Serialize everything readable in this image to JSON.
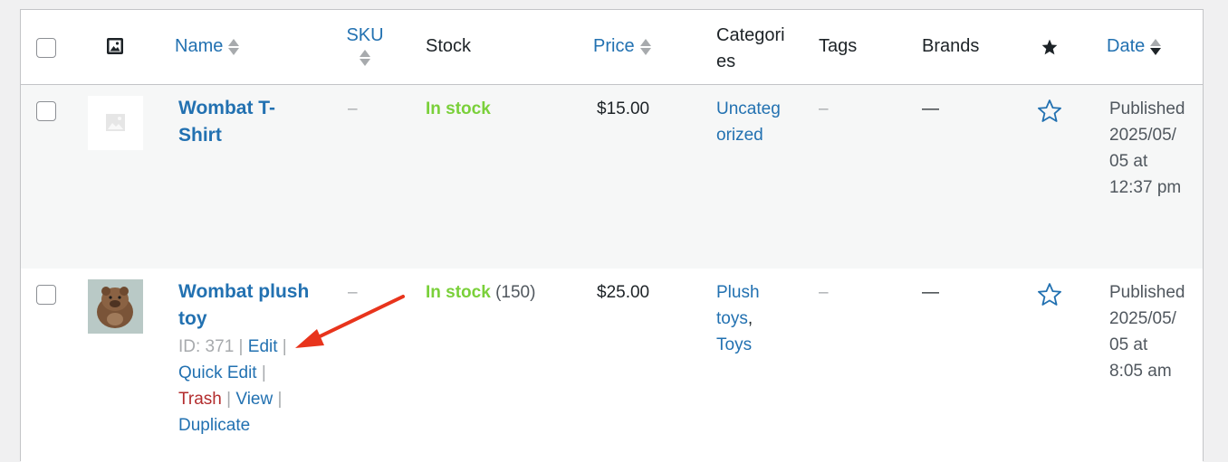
{
  "header": {
    "name": "Name",
    "sku": "SKU",
    "stock": "Stock",
    "price": "Price",
    "categories_1": "Categori",
    "categories_2": "es",
    "tags": "Tags",
    "brands": "Brands",
    "date": "Date",
    "thumb_icon": "image-icon",
    "featured_icon": "star-filled-icon"
  },
  "rows": [
    {
      "name_1": "Wombat T-",
      "name_2": "Shirt",
      "sku": "–",
      "stock": "In stock",
      "stock_qty": "",
      "price": "$15.00",
      "cat_1": "Uncateg",
      "cat_2": "orized",
      "tags": "–",
      "brands": "—",
      "date_1": "Published",
      "date_2": "2025/05/",
      "date_3": "05 at",
      "date_4": "12:37 pm"
    },
    {
      "name_1": "Wombat plush",
      "name_2": "toy",
      "id_label": "ID: 371",
      "edit": "Edit",
      "quick_edit": "Quick Edit",
      "trash": "Trash",
      "view": "View",
      "duplicate": "Duplicate",
      "sep": "|",
      "sku": "–",
      "stock": "In stock",
      "stock_qty": "(150)",
      "price": "$25.00",
      "cat_1": "Plush",
      "cat_2": "toys",
      "cat_comma": ",",
      "cat_3": "Toys",
      "tags": "–",
      "brands": "—",
      "date_1": "Published",
      "date_2": "2025/05/",
      "date_3": "05 at",
      "date_4": "8:05 am"
    }
  ],
  "colors": {
    "link": "#2271b1",
    "in_stock": "#7ad03a",
    "trash": "#b32d2e",
    "arrow": "#e8341c"
  }
}
